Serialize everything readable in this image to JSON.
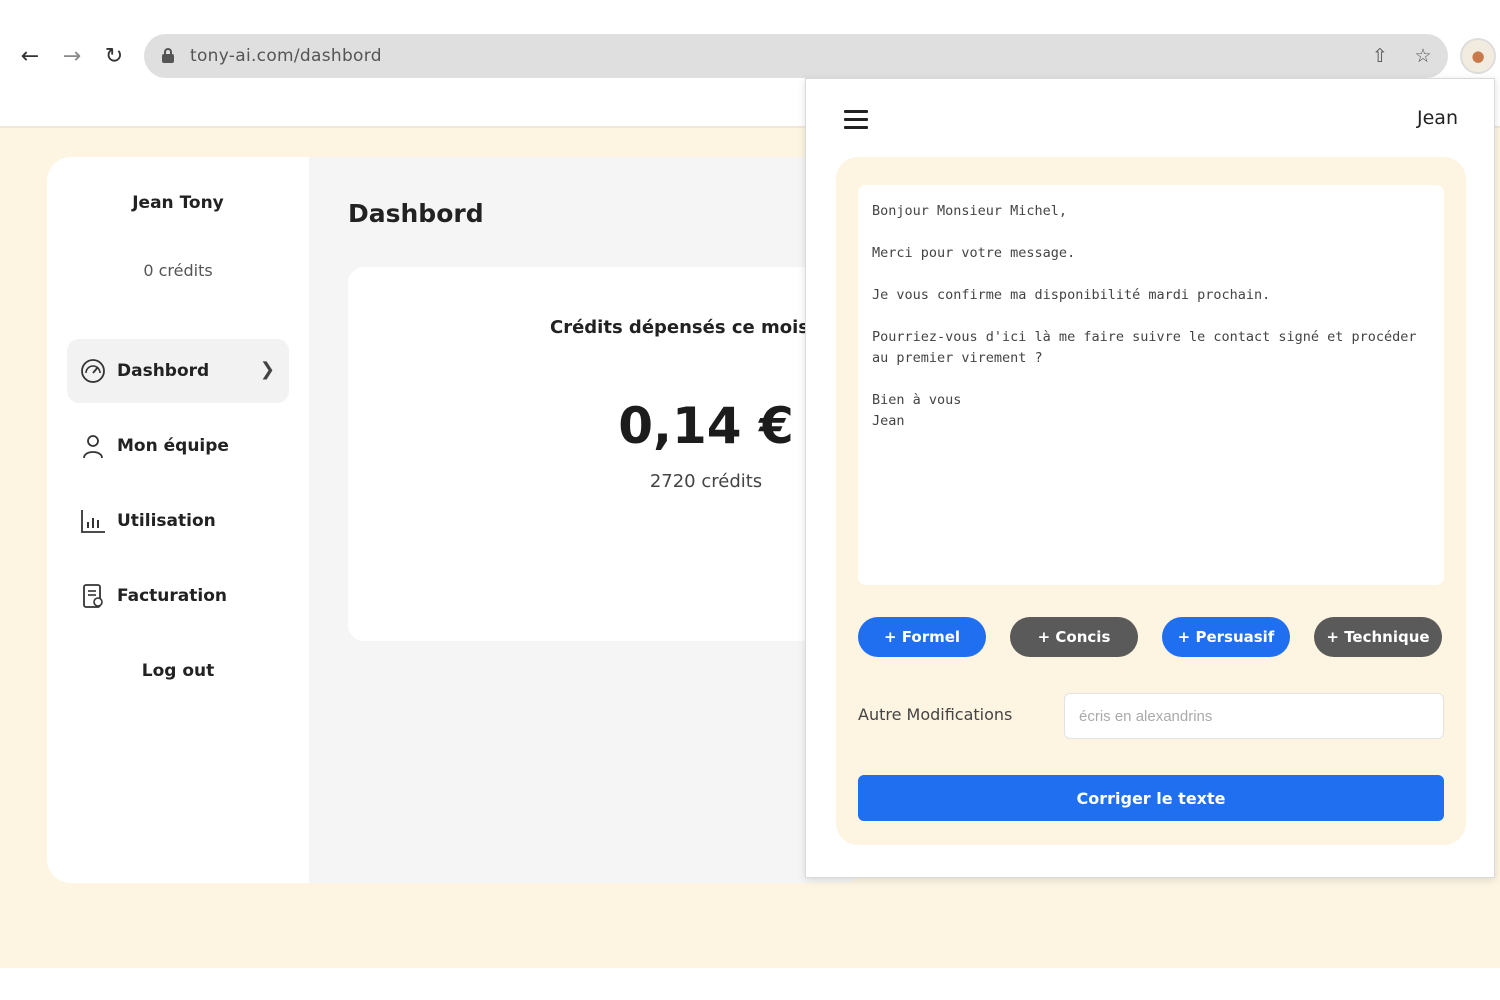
{
  "browser": {
    "url": "tony-ai.com/dashbord",
    "icons": {
      "back": "arrow-left-icon",
      "forward": "arrow-right-icon",
      "reload": "reload-icon",
      "share": "share-icon",
      "bookmark": "star-icon",
      "extension": "extension-icon"
    }
  },
  "sidebar": {
    "user_name": "Jean Tony",
    "credits": "0 crédits",
    "items": [
      {
        "label": "Dashbord",
        "icon": "gauge-icon"
      },
      {
        "label": "Mon équipe",
        "icon": "user-icon"
      },
      {
        "label": "Utilisation",
        "icon": "bar-chart-icon"
      },
      {
        "label": "Facturation",
        "icon": "invoice-icon"
      }
    ],
    "logout": "Log out"
  },
  "main": {
    "title": "Dashbord",
    "stat": {
      "label": "Crédits dépensés ce mois",
      "value": "0,14 €",
      "sub": "2720 crédits"
    }
  },
  "popup": {
    "user": "Jean",
    "text": "Bonjour Monsieur Michel,\n\nMerci pour votre message.\n\nJe vous confirme ma disponibilité mardi prochain.\n\nPourriez-vous d'ici là me faire suivre le contact signé et procéder\nau premier virement ?\n\nBien à vous\nJean",
    "chips": [
      {
        "label": "+ Formel",
        "active": true
      },
      {
        "label": "+ Concis",
        "active": false
      },
      {
        "label": "+ Persuasif",
        "active": true
      },
      {
        "label": "+ Technique",
        "active": false
      }
    ],
    "modifications_label": "Autre Modifications",
    "modifications_placeholder": "écris en alexandrins",
    "submit": "Corriger le texte"
  },
  "colors": {
    "accent": "#1f6ff0",
    "chip_inactive": "#5a5a5a",
    "page_bg": "#fdf5e2"
  }
}
